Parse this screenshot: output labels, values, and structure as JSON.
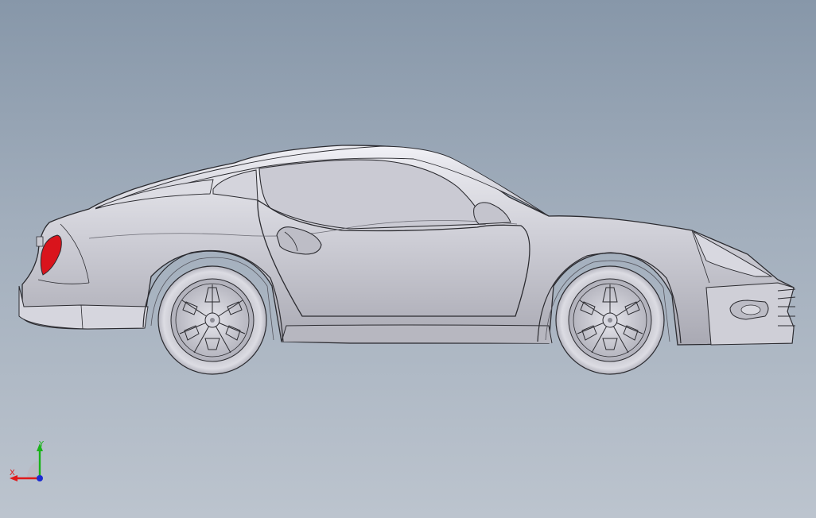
{
  "viewport": {
    "background_top": "#8797a9",
    "background_bottom": "#bcc4ce",
    "model_body_color": "#c9c9d1",
    "model_edge_color": "#2b2b30",
    "taillight_color": "#d9141c"
  },
  "triad": {
    "y_label": "Y",
    "x_label": "X",
    "y_color": "#19b319",
    "x_color": "#e01a1a",
    "z_color": "#1b2bd1"
  }
}
